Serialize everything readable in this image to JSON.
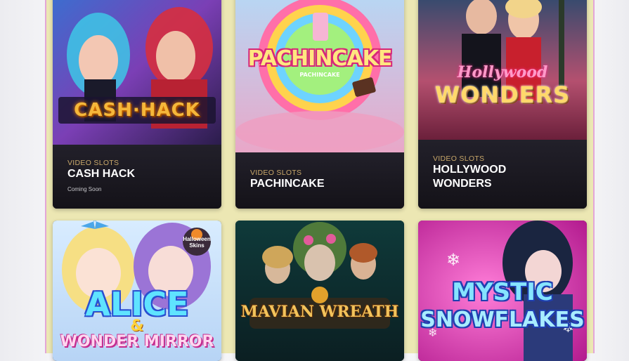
{
  "games": [
    {
      "category": "VIDEO SLOTS",
      "title": "CASH HACK",
      "status": "Coming Soon",
      "logo": "CASH·HACK"
    },
    {
      "category": "VIDEO SLOTS",
      "title": "PACHINCAKE",
      "logo": "PACHINCAKE",
      "sublogo": "PACHINCAKE"
    },
    {
      "category": "VIDEO SLOTS",
      "title_line1": "HOLLYWOOD",
      "title_line2": "WONDERS",
      "logo_script": "Hollywood",
      "logo": "WONDERS"
    },
    {
      "logo_line1": "ALICE",
      "logo_amp": "&",
      "logo_line2": "WONDER MIRROR",
      "badge_line1": "Halloween",
      "badge_line2": "Skins"
    },
    {
      "logo": "MAVIAN WREATH"
    },
    {
      "logo_line1": "MYSTIC",
      "logo_line2": "SNOWFLAKES"
    }
  ]
}
